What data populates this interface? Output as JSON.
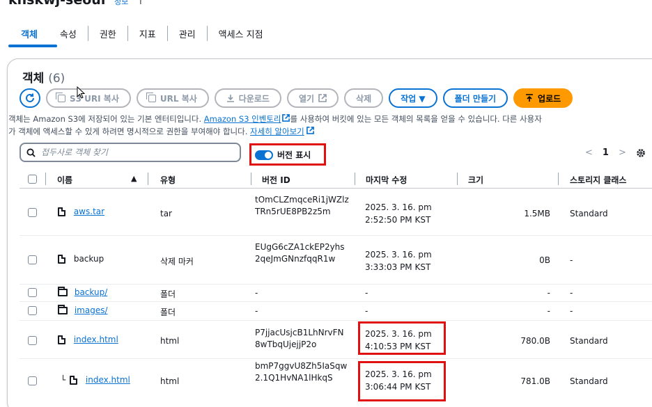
{
  "bucket": {
    "name": "khskwj-seoul",
    "info": "정보",
    "cursor_mark": "↑"
  },
  "tabs": [
    "객체",
    "속성",
    "권한",
    "지표",
    "관리",
    "액세스 지점"
  ],
  "objects_panel": {
    "title": "객체",
    "count": "(6)",
    "toolbar": {
      "refresh_icon": "refresh-icon",
      "copy_s3_uri": "S3 URI 복사",
      "copy_url": "URL 복사",
      "download": "다운로드",
      "open": "열기",
      "open_icon": "external-link-icon",
      "delete": "삭제",
      "actions": "작업 ▼",
      "create_folder": "폴더 만들기",
      "upload": "업로드"
    },
    "description_line1_a": "객체는 Amazon S3에 저장되어 있는 기본 엔터티입니다. ",
    "description_link1": "Amazon S3 인벤토리",
    "description_line1_b": "를 사용하여 버킷에 있는 모든 객체의 목록을 얻을 수 있습니다. 다른 사용자",
    "description_line2_a": "가 객체에 액세스할 수 있게 하려면 명시적으로 권한을 부여해야 합니다. ",
    "description_link2": "자세히 알아보기",
    "search_placeholder": "접두사로 객체 찾기",
    "show_versions_label": "버전 표시",
    "show_versions_on": true,
    "pagination": {
      "prev": "<",
      "page": "1",
      "next": ">"
    }
  },
  "table": {
    "headers": {
      "name": "이름",
      "sort": "▲",
      "type": "유형",
      "version_id": "버전 ID",
      "last_modified": "마지막 수정",
      "size": "크기",
      "storage_class": "스토리지 클래스"
    },
    "rows": [
      {
        "icon": "file-icon",
        "name": "aws.tar",
        "is_link": true,
        "type": "tar",
        "version_id": "tOmCLZmqceRi1jWZlzTRn5rUE8PB2z5m",
        "modified_date": "2025. 3. 16. pm",
        "modified_time": "2:52:50 PM KST",
        "size": "1.5MB",
        "storage": "Standard"
      },
      {
        "icon": "file-icon",
        "name": "backup",
        "is_link": false,
        "type": "삭제 마커",
        "version_id": "EUgG6cZA1ckEP2yhs2qeJmGNnzfqqR1w",
        "modified_date": "2025. 3. 16. pm",
        "modified_time": "3:33:03 PM KST",
        "size": "0B",
        "storage": "-"
      },
      {
        "icon": "folder-icon",
        "name": "backup/",
        "is_link": true,
        "type": "폴더",
        "version_id": "-",
        "modified_date": "-",
        "modified_time": "",
        "size": "-",
        "storage": "-"
      },
      {
        "icon": "folder-icon",
        "name": "images/",
        "is_link": true,
        "type": "폴더",
        "version_id": "-",
        "modified_date": "-",
        "modified_time": "",
        "size": "-",
        "storage": "-"
      },
      {
        "icon": "file-icon",
        "name": "index.html",
        "is_link": true,
        "type": "html",
        "version_id": "P7jjacUsjcB1LhNrvFN8wTbqUjejjP2o",
        "modified_date": "2025. 3. 16. pm",
        "modified_time": "4:10:53 PM KST",
        "size": "780.0B",
        "storage": "Standard"
      },
      {
        "icon": "file-icon",
        "name": "index.html",
        "version_prefix": "└",
        "is_link": true,
        "type": "html",
        "version_id": "bmP7ggvU8Zh5IaSqw2.1Q1HvNA1lHkqS",
        "modified_date": "2025. 3. 16. pm",
        "modified_time": "3:06:44 PM KST",
        "size": "781.0B",
        "storage": "Standard"
      }
    ]
  },
  "colors": {
    "accent": "#0972d3",
    "upload": "#ff9900",
    "highlight": "#e01010"
  }
}
